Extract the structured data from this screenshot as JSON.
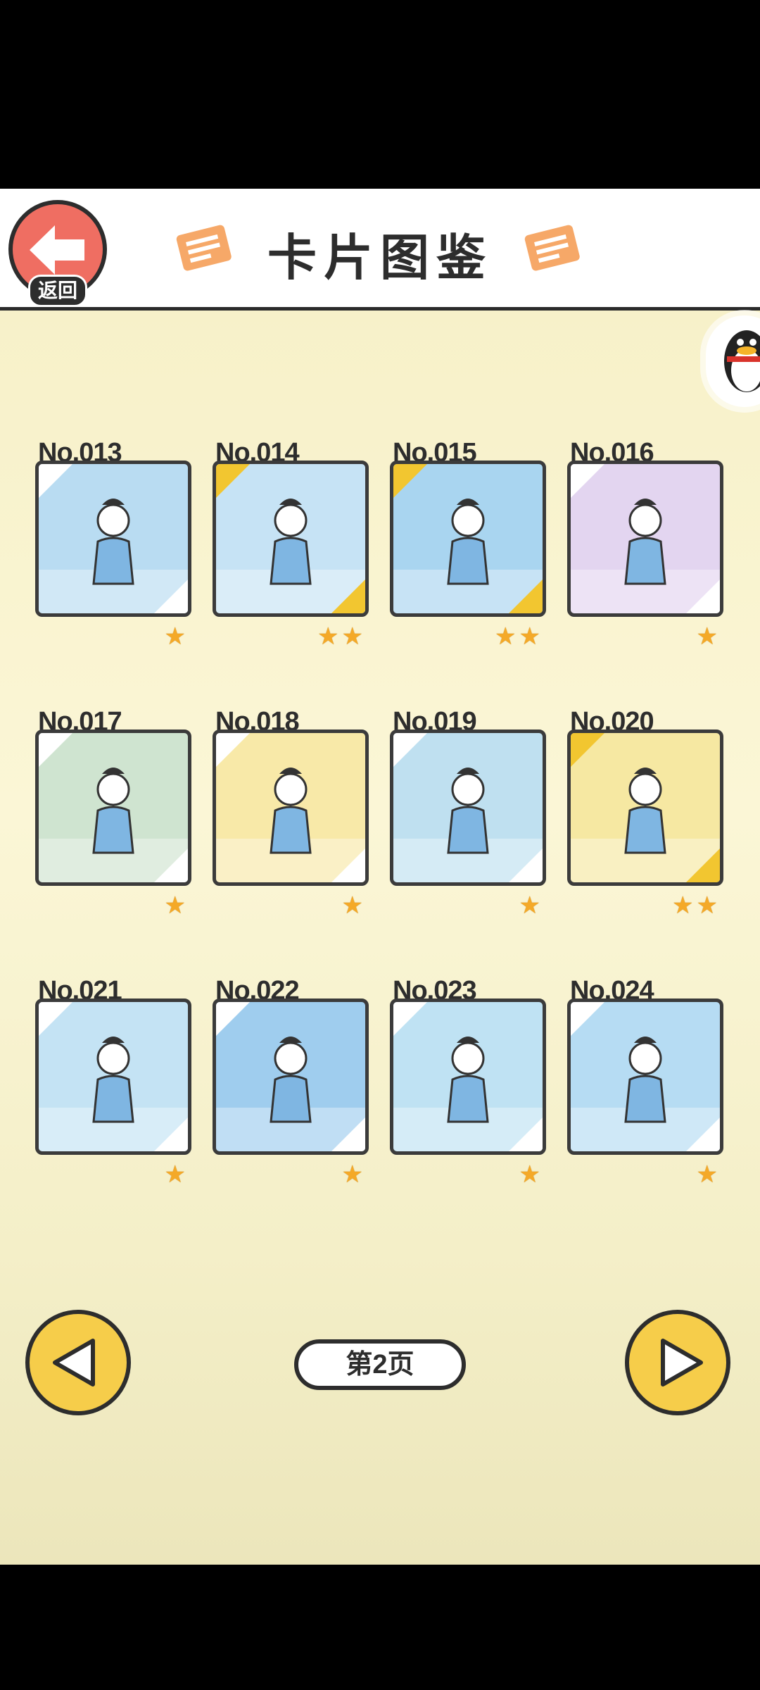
{
  "header": {
    "back_label": "返回",
    "title": "卡片图鉴"
  },
  "colors": {
    "accent": "#ef6e62",
    "nav_button": "#f6cd4a",
    "star": "#f4a928",
    "gold_corner": "#f2c630"
  },
  "cards": [
    {
      "no": "No.013",
      "stars": "★",
      "gold": false,
      "bg": "#b9dcf2"
    },
    {
      "no": "No.014",
      "stars": "★★",
      "gold": true,
      "bg": "#c6e3f5"
    },
    {
      "no": "No.015",
      "stars": "★★",
      "gold": true,
      "bg": "#a9d5f0"
    },
    {
      "no": "No.016",
      "stars": "★",
      "gold": false,
      "bg": "#e3d5f0"
    },
    {
      "no": "No.017",
      "stars": "★",
      "gold": false,
      "bg": "#cfe4d0"
    },
    {
      "no": "No.018",
      "stars": "★",
      "gold": false,
      "bg": "#f8e9a8"
    },
    {
      "no": "No.019",
      "stars": "★",
      "gold": false,
      "bg": "#bfe0f0"
    },
    {
      "no": "No.020",
      "stars": "★★",
      "gold": true,
      "bg": "#f6e8a2"
    },
    {
      "no": "No.021",
      "stars": "★",
      "gold": false,
      "bg": "#c4e3f4"
    },
    {
      "no": "No.022",
      "stars": "★",
      "gold": false,
      "bg": "#9fcdee"
    },
    {
      "no": "No.023",
      "stars": "★",
      "gold": false,
      "bg": "#bfe2f3"
    },
    {
      "no": "No.024",
      "stars": "★",
      "gold": false,
      "bg": "#b6dcf3"
    }
  ],
  "pagination": {
    "label": "第2页"
  }
}
